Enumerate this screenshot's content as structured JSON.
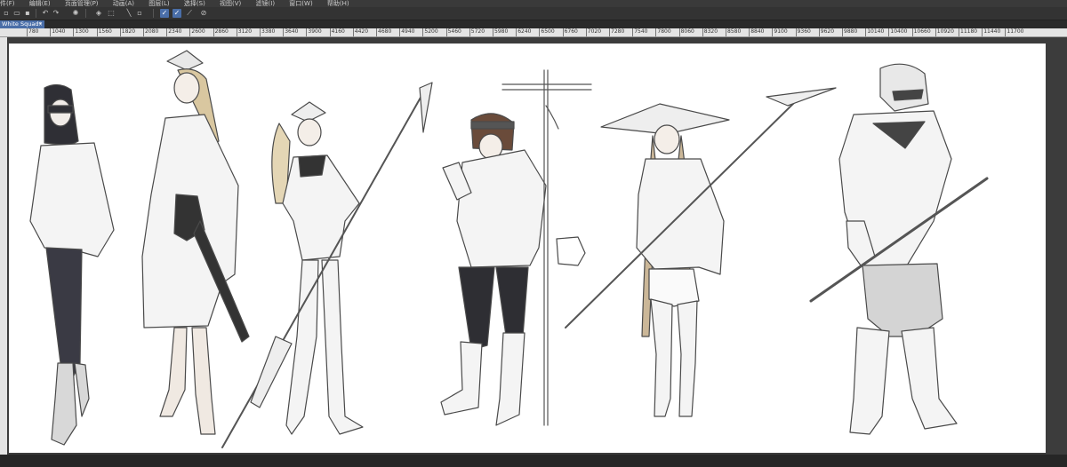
{
  "menu": {
    "items": [
      "件(F)",
      "编辑(E)",
      "页面管理(P)",
      "动画(A)",
      "图层(L)",
      "选择(S)",
      "视图(V)",
      "滤镜(I)",
      "窗口(W)",
      "帮助(H)"
    ]
  },
  "document": {
    "tab_title": "White Squad*",
    "close_glyph": "×"
  },
  "ruler": {
    "labels": [
      "780",
      "1040",
      "1300",
      "1560",
      "1820",
      "2080",
      "2340",
      "2600",
      "2860",
      "3120",
      "3380",
      "3640",
      "3900",
      "4160",
      "4420",
      "4680",
      "4940",
      "5200",
      "5460",
      "5720",
      "5980",
      "6240",
      "6500",
      "6760",
      "7020",
      "7280",
      "7540",
      "7800",
      "8060",
      "8320",
      "8580",
      "8840",
      "9100",
      "9360",
      "9620",
      "9880",
      "10140",
      "10400",
      "10660",
      "10920",
      "11180",
      "11440",
      "11700"
    ]
  },
  "toolbar": {
    "icons": [
      "new-icon",
      "open-icon",
      "save-icon",
      "undo-icon",
      "redo-icon",
      "loading-icon",
      "transform-icon",
      "selection-icon",
      "clear-icon",
      "pen-icon",
      "ruler-pen-icon",
      "eraser-icon",
      "correction-icon"
    ]
  },
  "colors": {
    "ui_dark": "#2b2b2b",
    "accent": "#4a6ea8",
    "canvas": "#ffffff",
    "line": "#444444"
  }
}
